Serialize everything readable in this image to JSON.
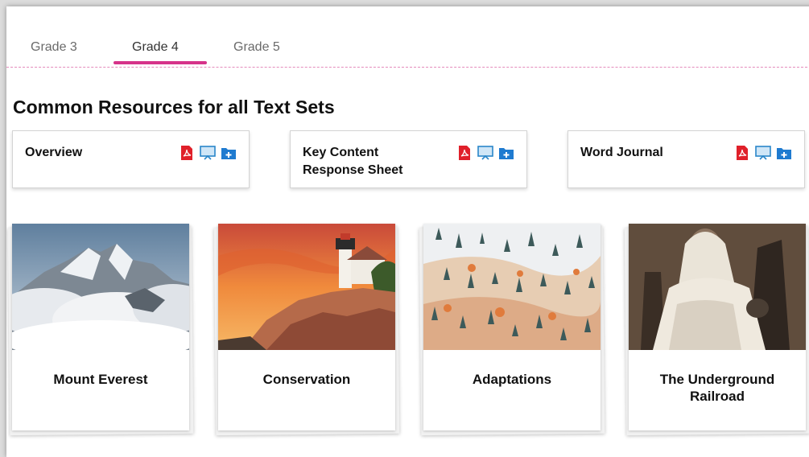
{
  "tabs": [
    {
      "label": "Grade 3",
      "active": false
    },
    {
      "label": "Grade 4",
      "active": true
    },
    {
      "label": "Grade 5",
      "active": false
    }
  ],
  "accent_color": "#d6338a",
  "section_title": "Common Resources for all Text Sets",
  "resources": [
    {
      "label": "Overview",
      "icons": [
        "pdf-icon",
        "presentation-icon",
        "add-to-folder-icon"
      ]
    },
    {
      "label": "Key Content Response Sheet",
      "icons": [
        "pdf-icon",
        "presentation-icon",
        "add-to-folder-icon"
      ]
    },
    {
      "label": "Word Journal",
      "icons": [
        "pdf-icon",
        "presentation-icon",
        "add-to-folder-icon"
      ]
    }
  ],
  "topics": [
    {
      "label": "Mount Everest",
      "image": "snowy mountain peaks above clouds"
    },
    {
      "label": "Conservation",
      "image": "lighthouse on a rocky coast at sunset"
    },
    {
      "label": "Adaptations",
      "image": "snowy forest with autumn trees"
    },
    {
      "label": "The Underground Railroad",
      "image": "historic portrait of a seated woman"
    }
  ]
}
